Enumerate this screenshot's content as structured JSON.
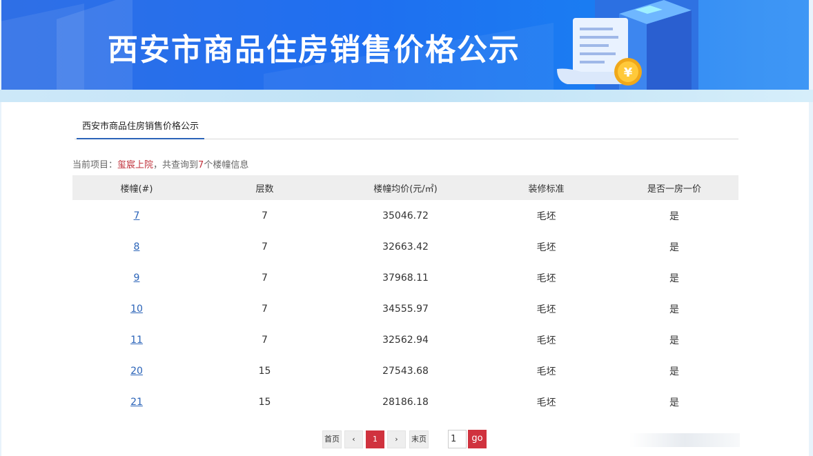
{
  "banner": {
    "title": "西安市商品住房销售价格公示",
    "coin_symbol": "¥"
  },
  "tab": {
    "label": "西安市商品住房销售价格公示"
  },
  "info": {
    "prefix": "当前项目：",
    "project": "玺宸上院",
    "middle": "，共查询到",
    "count": "7",
    "suffix": "个楼幢信息"
  },
  "table": {
    "headers": [
      "楼幢(#)",
      "层数",
      "楼幢均价(元/㎡)",
      "装修标准",
      "是否一房一价"
    ],
    "rows": [
      [
        "7",
        "7",
        "35046.72",
        "毛坯",
        "是"
      ],
      [
        "8",
        "7",
        "32663.42",
        "毛坯",
        "是"
      ],
      [
        "9",
        "7",
        "37968.11",
        "毛坯",
        "是"
      ],
      [
        "10",
        "7",
        "34555.97",
        "毛坯",
        "是"
      ],
      [
        "11",
        "7",
        "32562.94",
        "毛坯",
        "是"
      ],
      [
        "20",
        "15",
        "27543.68",
        "毛坯",
        "是"
      ],
      [
        "21",
        "15",
        "28186.18",
        "毛坯",
        "是"
      ]
    ]
  },
  "pagination": {
    "first": "首页",
    "prev": "‹",
    "current": "1",
    "next": "›",
    "last": "末页",
    "page_input": "1",
    "go": "go"
  },
  "colors": {
    "banner_blue": "#1f6ff0",
    "accent_red": "#d0323e",
    "link_blue": "#2a63b8"
  }
}
